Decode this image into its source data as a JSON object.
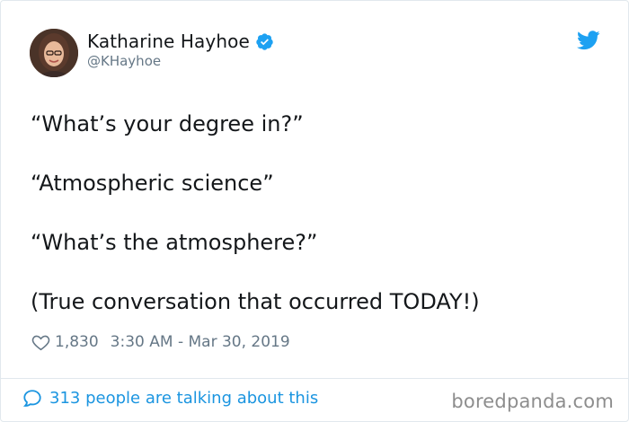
{
  "author": {
    "display_name": "Katharine Hayhoe",
    "handle": "@KHayhoe",
    "verified": true
  },
  "tweet": {
    "lines": [
      "“What’s your degree in?”",
      "“Atmospheric science”",
      "“What’s the atmosphere?”",
      "(True conversation that occurred TODAY!)"
    ]
  },
  "meta": {
    "likes": "1,830",
    "timestamp": "3:30 AM - Mar 30, 2019"
  },
  "footer": {
    "talking_about": "313 people are talking about this",
    "watermark": "boredpanda.com"
  },
  "colors": {
    "accent": "#1da1f2",
    "link": "#1b95e0",
    "muted": "#657786"
  },
  "icons": {
    "verified": "verified-badge-icon",
    "brand": "twitter-bird-icon",
    "like": "heart-icon",
    "reply": "speech-bubble-icon"
  }
}
